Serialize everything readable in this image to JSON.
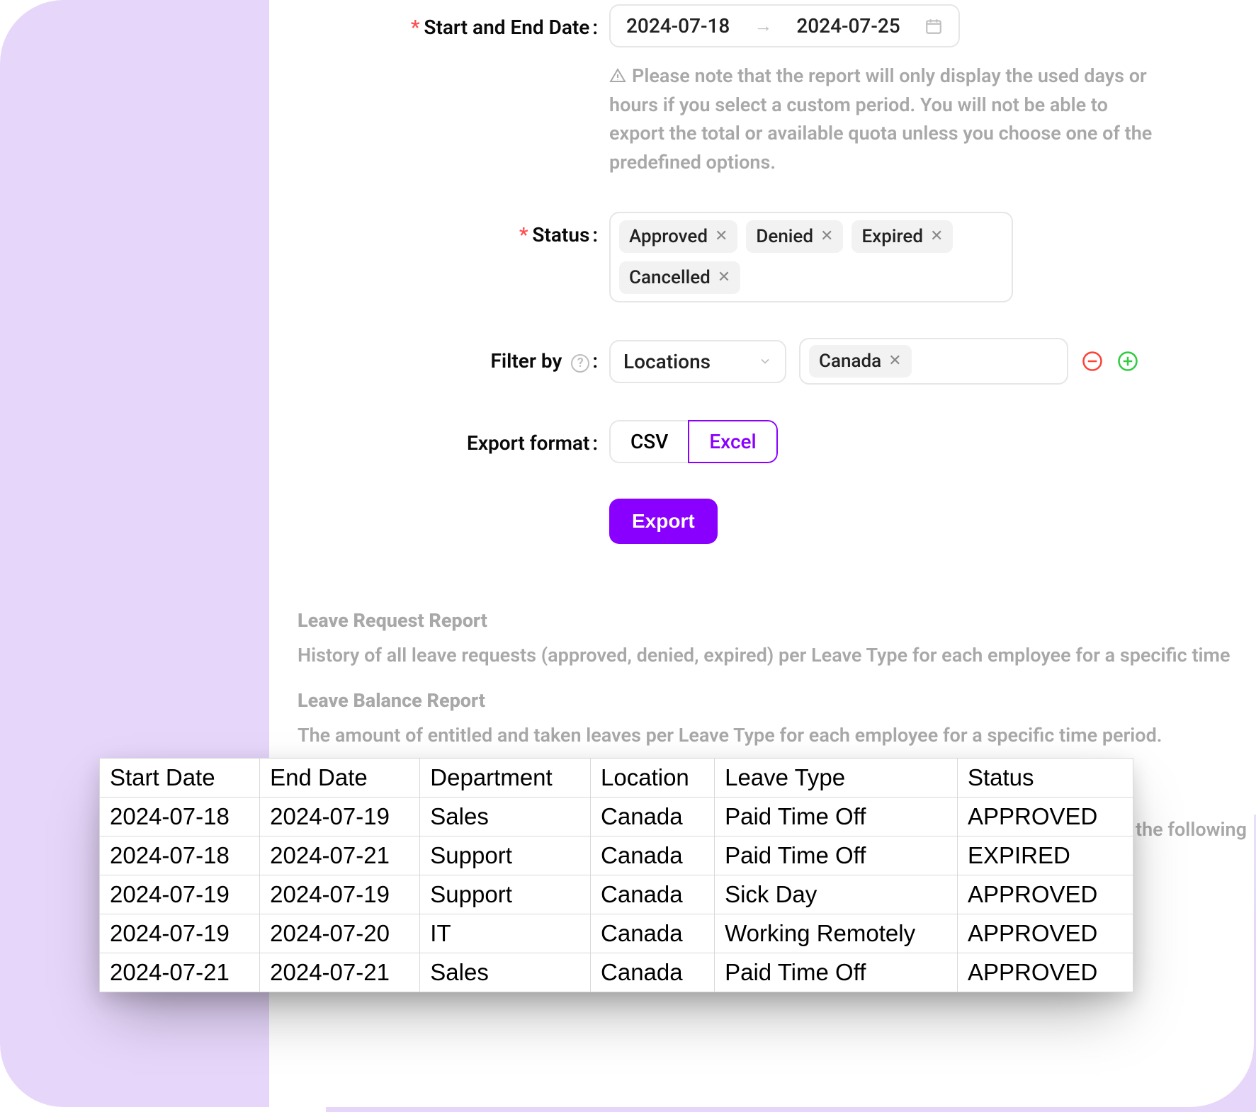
{
  "form": {
    "date": {
      "label": "Start and End Date",
      "start": "2024-07-18",
      "end": "2024-07-25",
      "note": "Please note that the report will only display the used days or hours if you select a custom period. You will not be able to export the total or available quota unless you choose one of the predefined options."
    },
    "status": {
      "label": "Status",
      "tags": [
        "Approved",
        "Denied",
        "Expired",
        "Cancelled"
      ]
    },
    "filter": {
      "label": "Filter by",
      "select": "Locations",
      "values": [
        "Canada"
      ]
    },
    "format": {
      "label": "Export format",
      "options": [
        "CSV",
        "Excel"
      ],
      "active": "Excel"
    },
    "export_label": "Export"
  },
  "desc": {
    "r1_title": "Leave Request Report",
    "r1_text": "History of all leave requests (approved, denied, expired) per Leave Type for each employee for a specific time",
    "r2_title": "Leave Balance Report",
    "r2_text": "The amount of entitled and taken leaves per Leave Type for each employee for a specific time period.",
    "hidden_trail": "the following"
  },
  "table": {
    "headers": [
      "Start Date",
      "End Date",
      "Department",
      "Location",
      "Leave Type",
      "Status"
    ],
    "rows": [
      [
        "2024-07-18",
        "2024-07-19",
        "Sales",
        "Canada",
        "Paid Time Off",
        "APPROVED"
      ],
      [
        "2024-07-18",
        "2024-07-21",
        "Support",
        "Canada",
        "Paid Time Off",
        "EXPIRED"
      ],
      [
        "2024-07-19",
        "2024-07-19",
        "Support",
        "Canada",
        "Sick Day",
        "APPROVED"
      ],
      [
        "2024-07-19",
        "2024-07-20",
        "IT",
        "Canada",
        "Working Remotely",
        "APPROVED"
      ],
      [
        "2024-07-21",
        "2024-07-21",
        "Sales",
        "Canada",
        "Paid Time Off",
        "APPROVED"
      ]
    ]
  },
  "chart_data": {
    "type": "table",
    "columns": [
      "Start Date",
      "End Date",
      "Department",
      "Location",
      "Leave Type",
      "Status"
    ],
    "rows": [
      [
        "2024-07-18",
        "2024-07-19",
        "Sales",
        "Canada",
        "Paid Time Off",
        "APPROVED"
      ],
      [
        "2024-07-18",
        "2024-07-21",
        "Support",
        "Canada",
        "Paid Time Off",
        "EXPIRED"
      ],
      [
        "2024-07-19",
        "2024-07-19",
        "Support",
        "Canada",
        "Sick Day",
        "APPROVED"
      ],
      [
        "2024-07-19",
        "2024-07-20",
        "IT",
        "Canada",
        "Working Remotely",
        "APPROVED"
      ],
      [
        "2024-07-21",
        "2024-07-21",
        "Sales",
        "Canada",
        "Paid Time Off",
        "APPROVED"
      ]
    ]
  }
}
